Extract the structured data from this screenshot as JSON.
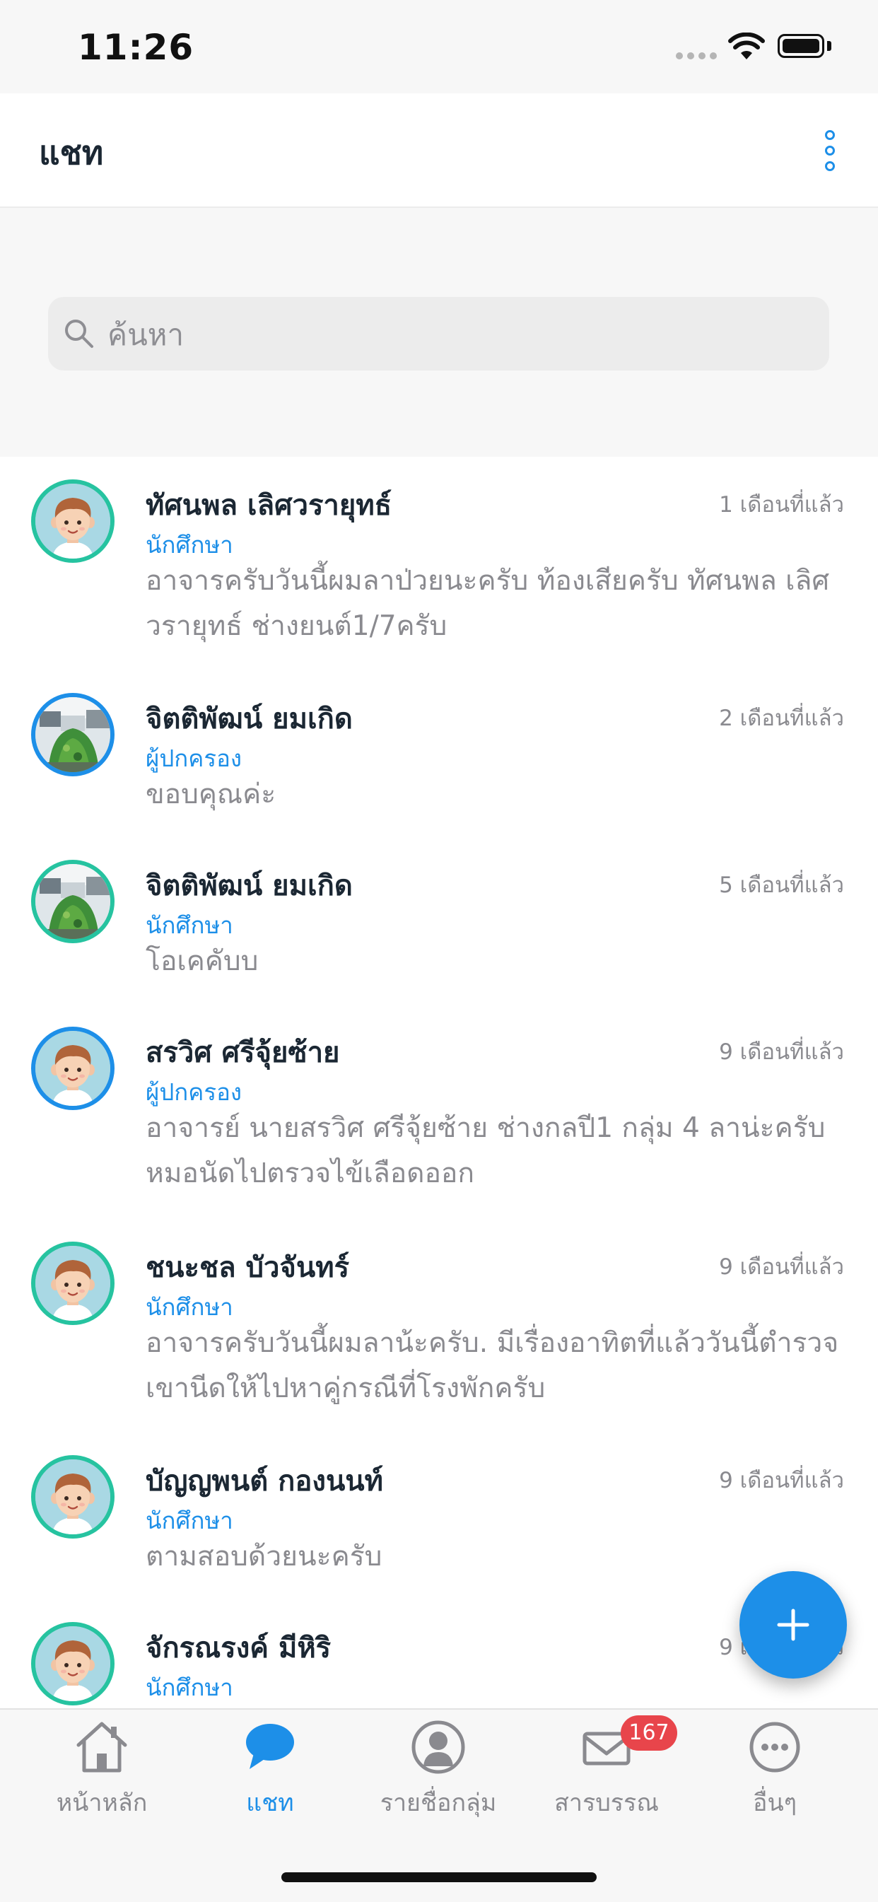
{
  "status_bar": {
    "time": "11:26"
  },
  "header": {
    "title": "แชท"
  },
  "search": {
    "placeholder": "ค้นหา"
  },
  "chats": [
    {
      "name": "ทัศนพล เลิศวรายุทธ์",
      "role": "นักศึกษา",
      "time": "1 เดือนที่แล้ว",
      "message": "อาจารครับวันนี้ผมลาป่วยนะครับ ท้องเสียครับ ทัศนพล เลิศวรายุทธ์ ช่างยนต์1/7ครับ",
      "avatar": "cartoon-boy"
    },
    {
      "name": "จิตติพัฒน์ ยมเกิด",
      "role": "ผู้ปกครอง",
      "time": "2 เดือนที่แล้ว",
      "message": "ขอบคุณค่ะ",
      "avatar": "photo"
    },
    {
      "name": "จิตติพัฒน์ ยมเกิด",
      "role": "นักศึกษา",
      "time": "5 เดือนที่แล้ว",
      "message": "โอเคคับบ",
      "avatar": "photo"
    },
    {
      "name": "สรวิศ ศรีจุ้ยซ้าย",
      "role": "ผู้ปกครอง",
      "time": "9 เดือนที่แล้ว",
      "message": "อาจารย์ นายสรวิศ ศรีจุ้ยซ้าย ช่างกลปี1 กลุ่ม 4 ลาน่ะครับ หมอนัดไปตรวจไข้เลือดออก",
      "avatar": "cartoon-boy"
    },
    {
      "name": "ชนะชล บัวจันทร์",
      "role": "นักศึกษา",
      "time": "9 เดือนที่แล้ว",
      "message": "อาจารครับวันนี้ผมลาน้ะครับ. มีเรื่องอาทิตที่แล้ววันนี้ตำรวจเขานีดให้ไปหาคู่กรณีที่โรงพักครับ",
      "avatar": "cartoon-boy"
    },
    {
      "name": "บัญญพนต์ กองนนท์",
      "role": "นักศึกษา",
      "time": "9 เดือนที่แล้ว",
      "message": "ตามสอบด้วยนะครับ",
      "avatar": "cartoon-boy"
    },
    {
      "name": "จักรณรงค์ มีหิริ",
      "role": "นักศึกษา",
      "time": "9 เดือนที่แล้ว",
      "message": "",
      "avatar": "cartoon-boy"
    }
  ],
  "tabs": [
    {
      "label": "หน้าหลัก",
      "icon": "home-icon",
      "active": false
    },
    {
      "label": "แชท",
      "icon": "chat-bubble-icon",
      "active": true
    },
    {
      "label": "รายชื่อกลุ่ม",
      "icon": "person-icon",
      "active": false
    },
    {
      "label": "สารบรรณ",
      "icon": "envelope-icon",
      "active": false,
      "badge": "167"
    },
    {
      "label": "อื่นๆ",
      "icon": "more-icon",
      "active": false
    }
  ],
  "colors": {
    "accent": "#1d8fe8",
    "student_ring": "#26c3a0",
    "parent_ring": "#1d8fe8",
    "badge": "#e8454b"
  }
}
